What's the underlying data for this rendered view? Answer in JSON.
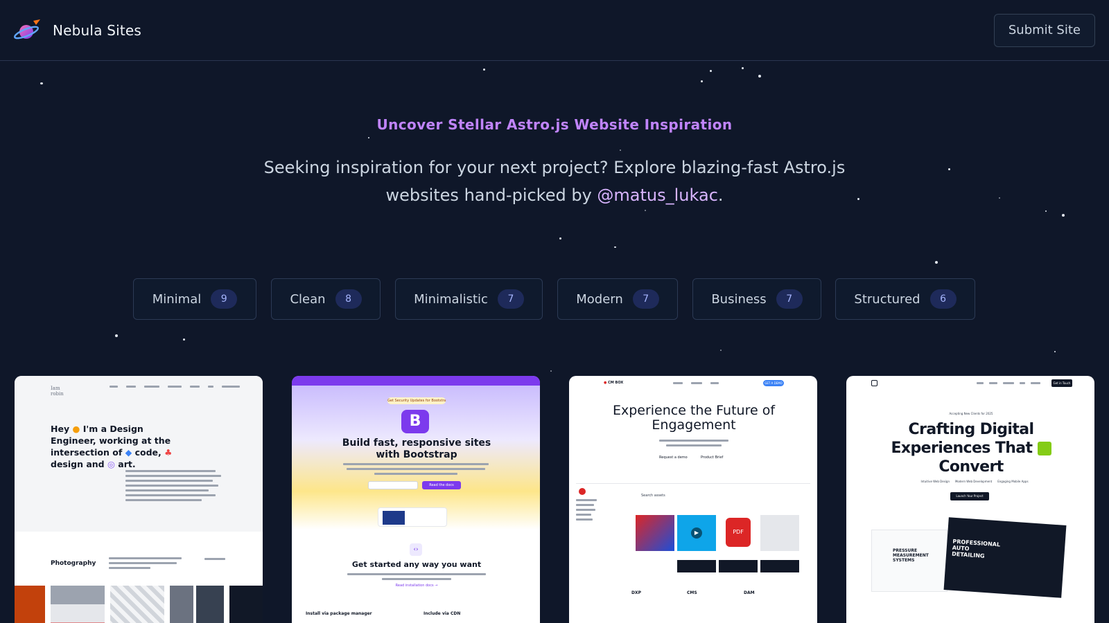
{
  "header": {
    "brand_name": "Nebula Sites",
    "submit_label": "Submit Site"
  },
  "hero": {
    "eyebrow": "Uncover Stellar Astro.js Website Inspiration",
    "intro_line1": "Seeking inspiration for your next project? Explore blazing-fast Astro.js",
    "intro_line2_prefix": "websites hand-picked by ",
    "intro_handle": "@matus_lukac",
    "intro_line2_suffix": "."
  },
  "tags": [
    {
      "label": "Minimal",
      "count": "9"
    },
    {
      "label": "Clean",
      "count": "8"
    },
    {
      "label": "Minimalistic",
      "count": "7"
    },
    {
      "label": "Modern",
      "count": "7"
    },
    {
      "label": "Business",
      "count": "7"
    },
    {
      "label": "Structured",
      "count": "6"
    }
  ],
  "cards": [
    {
      "logo": "Iam robin",
      "headline_a": "Hey",
      "headline_b": "I'm a Design Engineer, working at the intersection of",
      "headline_c": "code,",
      "headline_d": "design and",
      "headline_e": "art.",
      "section": "Photography"
    },
    {
      "badge": "Get Security Updates for Bootstrap 5 & 4",
      "logo_letter": "B",
      "headline": "Build fast, responsive sites with Bootstrap",
      "primary_btn": "Read the docs",
      "subhead": "Get started any way you want",
      "link": "Read installation docs →",
      "col1": "Install via package manager",
      "col2": "Include via CDN"
    },
    {
      "brand": "CM BOX",
      "cta": "GET A DEMO",
      "headline": "Experience the Future of Engagement",
      "btn1": "Request a demo",
      "btn2": "Product Brief",
      "search": "Search assets",
      "col1": "DXP",
      "col2": "CMS",
      "col3": "DAM"
    },
    {
      "cta": "Get in Touch",
      "badge": "Accepting New Clients for 2025",
      "headline_a": "Crafting Digital Experiences That",
      "headline_b": "Convert",
      "feature1": "Intuitive Web Design",
      "feature2": "Modern Web Development",
      "feature3": "Engaging Mobile Apps",
      "launch": "Launch Your Project",
      "mock_text": "PROFESSIONAL AUTO DETAILING",
      "mock_text2": "PRESSURE MEASUREMENT SYSTEMS"
    }
  ],
  "colors": {
    "background": "#0f1729",
    "accent": "#c084fc",
    "handle": "#d8b4fe"
  }
}
